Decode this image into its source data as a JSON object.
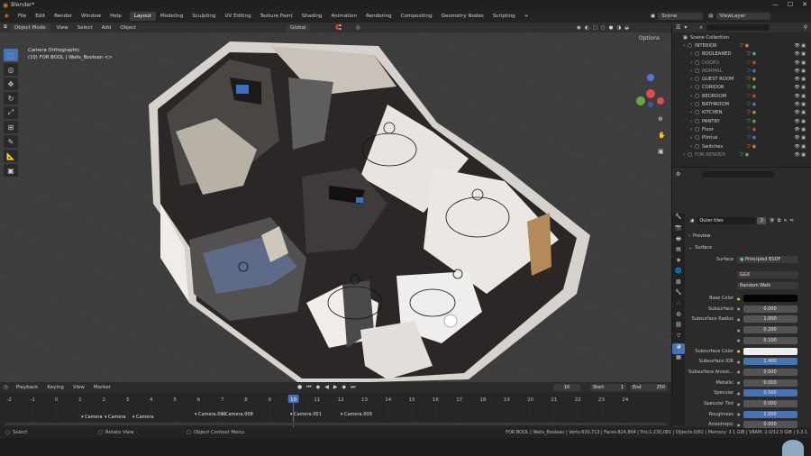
{
  "app": {
    "title": "Blender*"
  },
  "menu": {
    "items": [
      "File",
      "Edit",
      "Render",
      "Window",
      "Help"
    ]
  },
  "workspaces": [
    "Layout",
    "Modeling",
    "Sculpting",
    "UV Editing",
    "Texture Paint",
    "Shading",
    "Animation",
    "Rendering",
    "Compositing",
    "Geometry Nodes",
    "Scripting",
    "+"
  ],
  "scene": {
    "label": "Scene",
    "view_layer": "ViewLayer"
  },
  "viewport_header": {
    "mode": "Object Mode",
    "menus": [
      "View",
      "Select",
      "Add",
      "Object"
    ],
    "orientation": "Global",
    "options": "Options"
  },
  "viewport": {
    "camera_label": "Camera Orthographic",
    "object_label": "(10) FOR BOOL | Walls_Boolean <>"
  },
  "timeline": {
    "menus": [
      "Playback",
      "Keying",
      "View",
      "Marker"
    ],
    "current_frame": "10",
    "start_label": "Start",
    "start": "1",
    "end_label": "End",
    "end": "250",
    "ticks": [
      "-2",
      "-1",
      "0",
      "1",
      "2",
      "3",
      "4",
      "5",
      "6",
      "7",
      "8",
      "9",
      "10",
      "11",
      "12",
      "13",
      "14",
      "15",
      "16",
      "17",
      "18",
      "19",
      "20",
      "21",
      "22",
      "23",
      "24"
    ],
    "markers": [
      "Camera",
      "Camera",
      "Camera",
      "Camera.001",
      "Camera.008",
      "Camera.001",
      "Camera.009"
    ]
  },
  "status": {
    "select": "Select",
    "rotate": "Rotate View",
    "context": "Object Context Menu",
    "info": "FOR BOOL | Walls_Boolean | Verts:630,713 | Faces:824,864 | Tris:1,230,081 | Objects:0/82 | Memory: 3.1 GiB | VRAM: 2.0/12.0 GiB | 3.3.1"
  },
  "outliner": {
    "root": "Scene Collection",
    "items": [
      {
        "name": "INTERIOR"
      },
      {
        "name": "BOOLEANED"
      },
      {
        "name": "DOORS"
      },
      {
        "name": "NORMAL"
      },
      {
        "name": "GUEST ROOM"
      },
      {
        "name": "CORIDOR"
      },
      {
        "name": "BEDROOM"
      },
      {
        "name": "BATHROOM"
      },
      {
        "name": "KITCHEN"
      },
      {
        "name": "PANTRY"
      },
      {
        "name": "Floor"
      },
      {
        "name": "Plintus"
      },
      {
        "name": "Switches"
      },
      {
        "name": "FOR RENDER"
      }
    ]
  },
  "properties": {
    "material": "Outer tiles",
    "users": "3",
    "preview": "Preview",
    "surface_panel": "Surface",
    "surface_label": "Surface",
    "surface_value": "Principled BSDF",
    "distribution": "GGX",
    "subsurface_method": "Random Walk",
    "rows": [
      {
        "label": "Base Color",
        "value": ""
      },
      {
        "label": "Subsurface",
        "value": "0.000"
      },
      {
        "label": "Subsurface Radius",
        "value": "1.000"
      },
      {
        "label": "",
        "value": "0.200"
      },
      {
        "label": "",
        "value": "0.100"
      },
      {
        "label": "Subsurface Color",
        "value": ""
      },
      {
        "label": "Subsurface IOR",
        "value": "1.400"
      },
      {
        "label": "Subsurface Anisot...",
        "value": "0.000"
      },
      {
        "label": "Metallic",
        "value": "0.000"
      },
      {
        "label": "Specular",
        "value": "0.500"
      },
      {
        "label": "Specular Tint",
        "value": "0.000"
      },
      {
        "label": "Roughness",
        "value": "1.000"
      },
      {
        "label": "Anisotropic",
        "value": "0.000"
      }
    ]
  },
  "colors": {
    "accent": "#4772b3",
    "timeline_cursor": "#4772b3",
    "marker_text": "#e0e0e0"
  }
}
